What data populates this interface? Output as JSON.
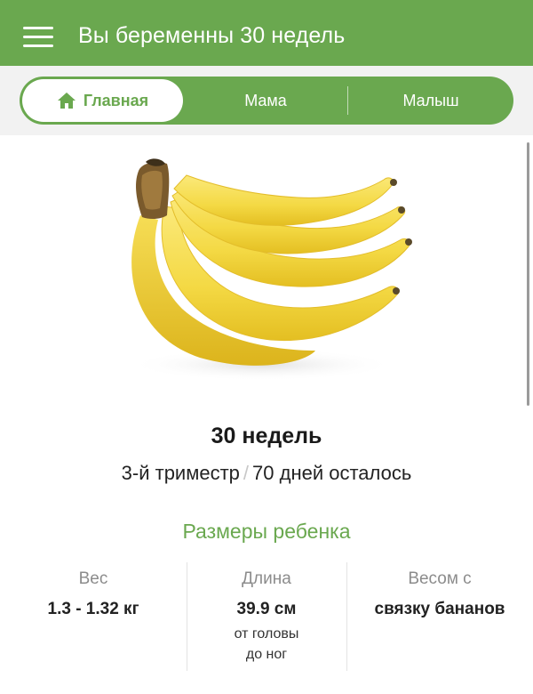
{
  "header": {
    "title": "Вы беременны 30 недель",
    "menu_icon": "hamburger-menu-icon",
    "background": "#6aa84f"
  },
  "tabs": [
    {
      "label": "Главная",
      "icon": "home-icon",
      "active": true
    },
    {
      "label": "Мама",
      "active": false
    },
    {
      "label": "Малыш",
      "active": false
    }
  ],
  "hero": {
    "image": "banana-bunch"
  },
  "week": {
    "title": "30 недель",
    "trimester": "3-й триместр",
    "separator": "/",
    "days_left": "70 дней осталось"
  },
  "sizes": {
    "heading": "Размеры ребенка",
    "items": [
      {
        "label": "Вес",
        "value": "1.3 - 1.32 кг"
      },
      {
        "label": "Длина",
        "value": "39.9 см",
        "note_1": "от головы",
        "note_2": "до ног"
      },
      {
        "label": "Весом с",
        "value": "связку бананов"
      }
    ]
  },
  "colors": {
    "accent": "#6aa84f",
    "tab_background": "#f2f2f2",
    "banana_yellow": "#f4d944"
  }
}
